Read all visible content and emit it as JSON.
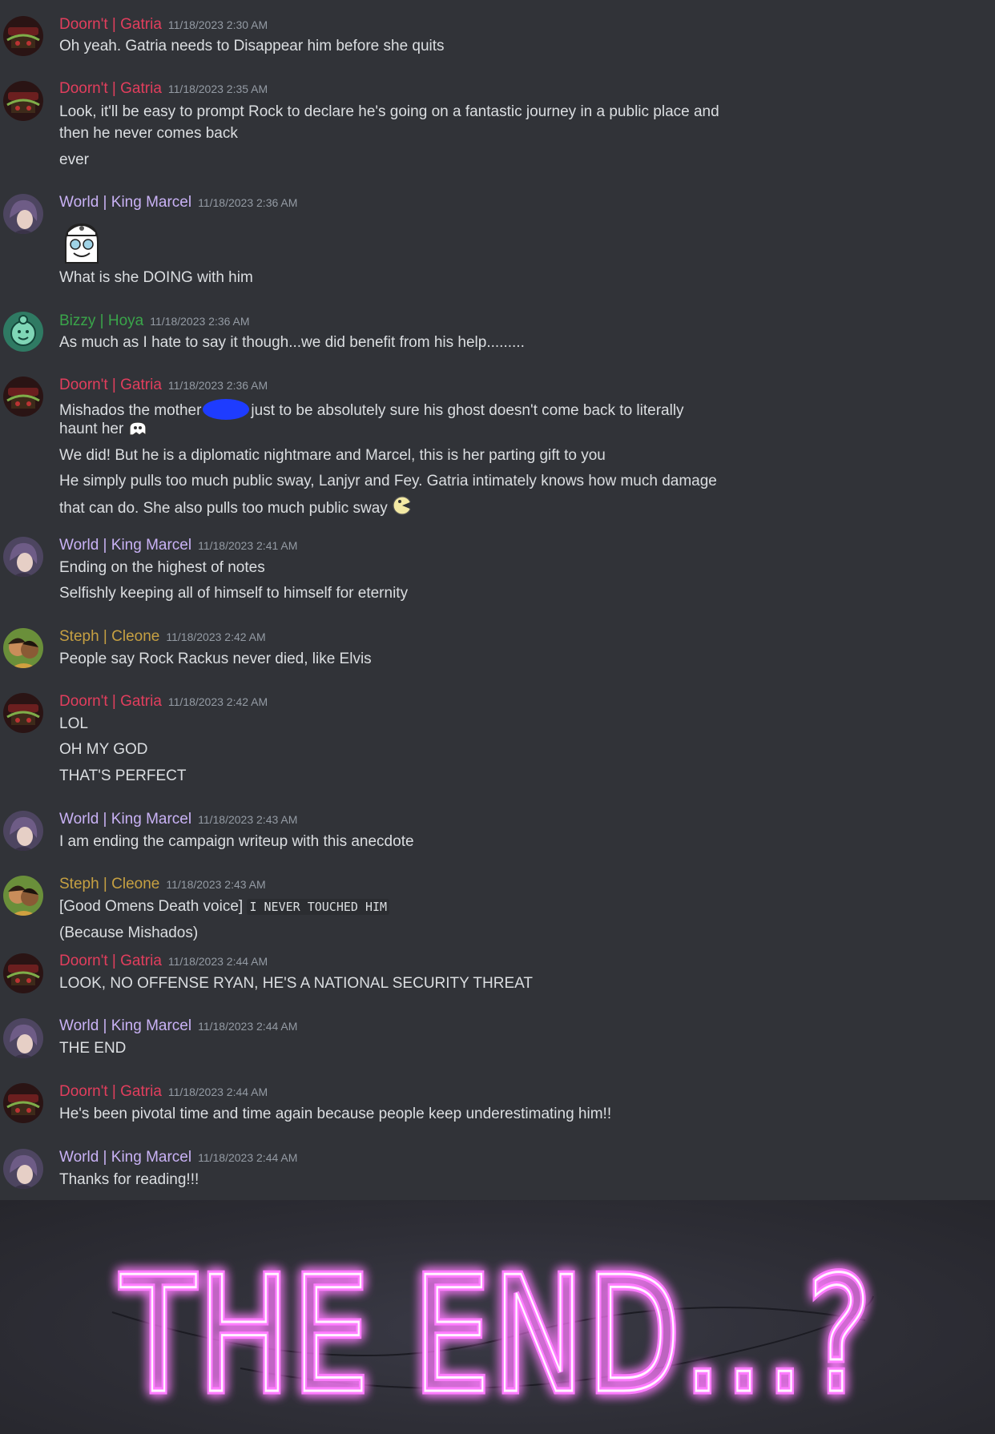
{
  "colors": {
    "gatria": "#e23e5d",
    "marcel": "#c9b2f5",
    "hoya": "#3aa54a",
    "cleone": "#c6a042",
    "neon": "#ff7cff"
  },
  "messages": [
    {
      "user": "Doorn't | Gatria",
      "role": "gatria",
      "timestamp": "11/18/2023 2:30 AM",
      "avatar": "gatria-avatar",
      "lines": [
        "Oh yeah. Gatria needs to Disappear him before she quits"
      ]
    },
    {
      "user": "Doorn't | Gatria",
      "role": "gatria",
      "timestamp": "11/18/2023 2:35 AM",
      "avatar": "gatria-avatar",
      "lines": [
        "Look, it'll be easy to prompt Rock to declare he's going on a fantastic journey in a public place and",
        "then he never comes back",
        "ever"
      ]
    },
    {
      "user": "World | King Marcel",
      "role": "marcel",
      "timestamp": "11/18/2023 2:36 AM",
      "avatar": "marcel-avatar",
      "sticker": "ghost-sticker-icon",
      "lines": [
        "What is she DOING with him"
      ]
    },
    {
      "user": "Bizzy | Hoya",
      "role": "hoya",
      "timestamp": "11/18/2023 2:36 AM",
      "avatar": "hoya-avatar",
      "lines": [
        "As much as I hate to say it though...we did benefit from his help........."
      ]
    },
    {
      "user": "Doorn't | Gatria",
      "role": "gatria",
      "timestamp": "11/18/2023 2:36 AM",
      "avatar": "gatria-avatar",
      "lines": [
        "Mishados the mother",
        "just to be absolutely sure his ghost doesn't come back to literally",
        "haunt her",
        "We did! But he is a diplomatic nightmare and Marcel, this is her parting gift to you",
        "He simply pulls too much public sway, Lanjyr and Fey. Gatria intimately knows how much damage",
        "that can do. She also pulls too much public sway"
      ]
    },
    {
      "user": "World | King Marcel",
      "role": "marcel",
      "timestamp": "11/18/2023 2:41 AM",
      "avatar": "marcel-avatar",
      "lines": [
        "Ending on the highest of notes",
        "Selfishly keeping all of himself to himself for eternity"
      ]
    },
    {
      "user": "Steph | Cleone",
      "role": "cleone",
      "timestamp": "11/18/2023 2:42 AM",
      "avatar": "cleone-avatar",
      "lines": [
        "People say Rock Rackus never died, like Elvis"
      ]
    },
    {
      "user": "Doorn't | Gatria",
      "role": "gatria",
      "timestamp": "11/18/2023 2:42 AM",
      "avatar": "gatria-avatar",
      "lines": [
        "LOL",
        "OH MY GOD",
        "THAT'S PERFECT"
      ]
    },
    {
      "user": "World | King Marcel",
      "role": "marcel",
      "timestamp": "11/18/2023 2:43 AM",
      "avatar": "marcel-avatar",
      "lines": [
        "I am ending the campaign writeup with this anecdote"
      ]
    },
    {
      "user": "Steph | Cleone",
      "role": "cleone",
      "timestamp": "11/18/2023 2:43 AM",
      "avatar": "cleone-avatar",
      "lines": [
        "[Good Omens Death voice]",
        "I NEVER TOUCHED HIM",
        "(Because Mishados)"
      ]
    },
    {
      "user": "Doorn't | Gatria",
      "role": "gatria",
      "timestamp": "11/18/2023 2:44 AM",
      "avatar": "gatria-avatar",
      "lines": [
        "LOOK, NO OFFENSE RYAN, HE'S A NATIONAL SECURITY THREAT"
      ]
    },
    {
      "user": "World | King Marcel",
      "role": "marcel",
      "timestamp": "11/18/2023 2:44 AM",
      "avatar": "marcel-avatar",
      "lines": [
        "THE END"
      ]
    },
    {
      "user": "Doorn't | Gatria",
      "role": "gatria",
      "timestamp": "11/18/2023 2:44 AM",
      "avatar": "gatria-avatar",
      "lines": [
        "He's been pivotal time and time again because people keep underestimating him!!"
      ]
    },
    {
      "user": "World | King Marcel",
      "role": "marcel",
      "timestamp": "11/18/2023 2:44 AM",
      "avatar": "marcel-avatar",
      "lines": [
        "Thanks for reading!!!"
      ]
    }
  ],
  "banner": {
    "text": "THE END...?"
  }
}
